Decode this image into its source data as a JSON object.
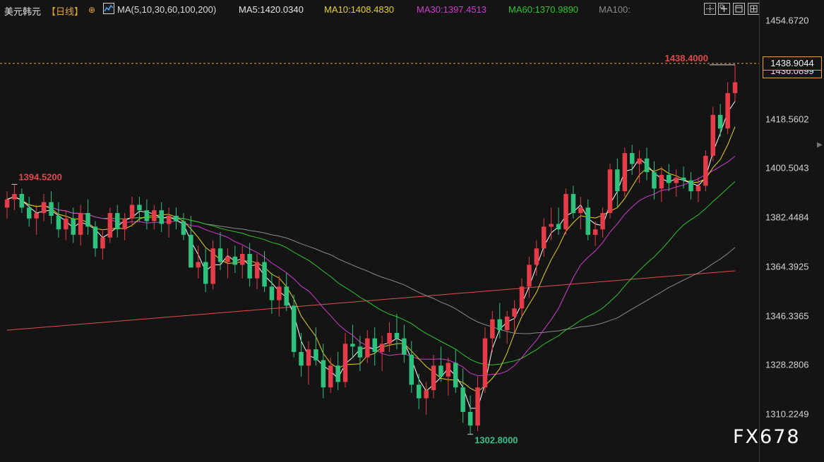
{
  "header": {
    "title": "美元韩元",
    "period": "【日线】",
    "crosshair_icon": "crosshair-icon",
    "ma_icon": "ma-indicator-icon",
    "ma_params": "MA(5,10,30,60,100,200)",
    "ma5": "MA5:1420.0340",
    "ma10": "MA10:1408.4830",
    "ma30": "MA30:1397.4513",
    "ma60": "MA60:1370.9890",
    "ma100": "MA100:"
  },
  "window_buttons": [
    "layout-grid-icon",
    "add-window-icon",
    "window-mode-icon",
    "maximize-icon"
  ],
  "colors": {
    "background": "#141414",
    "up": "#e63b48",
    "down": "#2ec27e",
    "ma5": "#ffffff",
    "ma10": "#e8d21c",
    "ma30": "#d23ad2",
    "ma60": "#2fc52f",
    "ma100": "#8a8a8a",
    "ma200": "#e34b4b",
    "last_price_line": "#e8a23a"
  },
  "annotations": {
    "high_label": "1438.4000",
    "left_high_label": "1394.5200",
    "low_label": "1302.8000"
  },
  "watermark": "FX678",
  "chart_data": {
    "type": "candlestick",
    "title": "美元韩元",
    "period": "日线",
    "y_ticks": [
      "1454.6720",
      "1418.5602",
      "1400.5043",
      "1382.4484",
      "1364.3925",
      "1346.3365",
      "1328.2806",
      "1310.2249"
    ],
    "ylim": [
      1296,
      1460
    ],
    "last_price": "1438.9044",
    "last_price_secondary": "1436.0899",
    "grid": false,
    "candles": [
      [
        1386,
        1392,
        1382,
        1389
      ],
      [
        1389,
        1394.52,
        1385,
        1391
      ],
      [
        1391,
        1393,
        1384,
        1386
      ],
      [
        1386,
        1390,
        1379,
        1382
      ],
      [
        1382,
        1387,
        1376,
        1384
      ],
      [
        1384,
        1391,
        1381,
        1388
      ],
      [
        1388,
        1392,
        1380,
        1383
      ],
      [
        1383,
        1388,
        1375,
        1378
      ],
      [
        1378,
        1385,
        1374,
        1382
      ],
      [
        1382,
        1386,
        1373,
        1376
      ],
      [
        1376,
        1387,
        1372,
        1384
      ],
      [
        1384,
        1389,
        1376,
        1379
      ],
      [
        1379,
        1381,
        1368,
        1371
      ],
      [
        1371,
        1378,
        1367,
        1375
      ],
      [
        1375,
        1386,
        1373,
        1384
      ],
      [
        1384,
        1387,
        1375,
        1378
      ],
      [
        1378,
        1384,
        1374,
        1382
      ],
      [
        1382,
        1390,
        1379,
        1387
      ],
      [
        1387,
        1390,
        1381,
        1385
      ],
      [
        1385,
        1389,
        1378,
        1381
      ],
      [
        1381,
        1387,
        1378,
        1385
      ],
      [
        1385,
        1388,
        1377,
        1380
      ],
      [
        1380,
        1386,
        1375,
        1383
      ],
      [
        1383,
        1386,
        1378,
        1381
      ],
      [
        1381,
        1384,
        1374,
        1376
      ],
      [
        1376,
        1383,
        1368,
        1364
      ],
      [
        1364,
        1372,
        1360,
        1366
      ],
      [
        1366,
        1371,
        1355,
        1358
      ],
      [
        1358,
        1374,
        1356,
        1371
      ],
      [
        1371,
        1377,
        1363,
        1366
      ],
      [
        1366,
        1371,
        1360,
        1368
      ],
      [
        1368,
        1372,
        1362,
        1365
      ],
      [
        1365,
        1372,
        1360,
        1369
      ],
      [
        1369,
        1373,
        1357,
        1360
      ],
      [
        1360,
        1369,
        1356,
        1366
      ],
      [
        1366,
        1370,
        1355,
        1357
      ],
      [
        1357,
        1362,
        1347,
        1352
      ],
      [
        1352,
        1361,
        1346,
        1357
      ],
      [
        1357,
        1362,
        1348,
        1350
      ],
      [
        1350,
        1354,
        1331,
        1333
      ],
      [
        1333,
        1340,
        1324,
        1328
      ],
      [
        1328,
        1337,
        1321,
        1334
      ],
      [
        1334,
        1342,
        1328,
        1330
      ],
      [
        1330,
        1336,
        1316,
        1320
      ],
      [
        1320,
        1331,
        1318,
        1328
      ],
      [
        1328,
        1333,
        1319,
        1322
      ],
      [
        1322,
        1340,
        1320,
        1336
      ],
      [
        1336,
        1343,
        1331,
        1335
      ],
      [
        1335,
        1339,
        1326,
        1331
      ],
      [
        1331,
        1341,
        1329,
        1338
      ],
      [
        1338,
        1342,
        1328,
        1333
      ],
      [
        1333,
        1339,
        1326,
        1336
      ],
      [
        1336,
        1344,
        1333,
        1340
      ],
      [
        1340,
        1347,
        1334,
        1338
      ],
      [
        1338,
        1343,
        1329,
        1332
      ],
      [
        1332,
        1337,
        1318,
        1321
      ],
      [
        1321,
        1325,
        1312,
        1316
      ],
      [
        1316,
        1322,
        1310,
        1319
      ],
      [
        1319,
        1332,
        1316,
        1328
      ],
      [
        1328,
        1335,
        1322,
        1324
      ],
      [
        1324,
        1331,
        1317,
        1329
      ],
      [
        1329,
        1334,
        1318,
        1320
      ],
      [
        1320,
        1327,
        1307,
        1311
      ],
      [
        1311,
        1317,
        1302.8,
        1306
      ],
      [
        1306,
        1324,
        1304,
        1320
      ],
      [
        1320,
        1342,
        1318,
        1338
      ],
      [
        1338,
        1348,
        1333,
        1345
      ],
      [
        1345,
        1351,
        1338,
        1341
      ],
      [
        1341,
        1348,
        1336,
        1346
      ],
      [
        1346,
        1352,
        1340,
        1349
      ],
      [
        1349,
        1360,
        1346,
        1357
      ],
      [
        1357,
        1368,
        1353,
        1365
      ],
      [
        1365,
        1374,
        1361,
        1371
      ],
      [
        1371,
        1382,
        1368,
        1379
      ],
      [
        1379,
        1386,
        1374,
        1380
      ],
      [
        1380,
        1386,
        1376,
        1378
      ],
      [
        1378,
        1393,
        1376,
        1391
      ],
      [
        1391,
        1394,
        1382,
        1384
      ],
      [
        1384,
        1390,
        1378,
        1386
      ],
      [
        1386,
        1389,
        1374,
        1376
      ],
      [
        1376,
        1381,
        1372,
        1378
      ],
      [
        1378,
        1386,
        1375,
        1384
      ],
      [
        1384,
        1402,
        1382,
        1400
      ],
      [
        1400,
        1404,
        1386,
        1392
      ],
      [
        1392,
        1408,
        1390,
        1406
      ],
      [
        1406,
        1409,
        1398,
        1402
      ],
      [
        1402,
        1407,
        1395,
        1404
      ],
      [
        1404,
        1408,
        1396,
        1399
      ],
      [
        1399,
        1403,
        1389,
        1393
      ],
      [
        1393,
        1401,
        1388,
        1398
      ],
      [
        1398,
        1402,
        1392,
        1395
      ],
      [
        1395,
        1400,
        1390,
        1397
      ],
      [
        1397,
        1401,
        1393,
        1396
      ],
      [
        1396,
        1399,
        1389,
        1392
      ],
      [
        1392,
        1397,
        1388,
        1394
      ],
      [
        1394,
        1407,
        1392,
        1405
      ],
      [
        1405,
        1423,
        1403,
        1420
      ],
      [
        1420,
        1424,
        1412,
        1415
      ],
      [
        1415,
        1432,
        1413,
        1428
      ],
      [
        1428,
        1438.4,
        1425,
        1432
      ]
    ],
    "ma": [
      {
        "name": "MA5",
        "value": "1420.0340"
      },
      {
        "name": "MA10",
        "value": "1408.4830"
      },
      {
        "name": "MA30",
        "value": "1397.4513"
      },
      {
        "name": "MA60",
        "value": "1370.9890"
      },
      {
        "name": "MA100",
        "value": ""
      },
      {
        "name": "MA200",
        "value": ""
      }
    ]
  }
}
